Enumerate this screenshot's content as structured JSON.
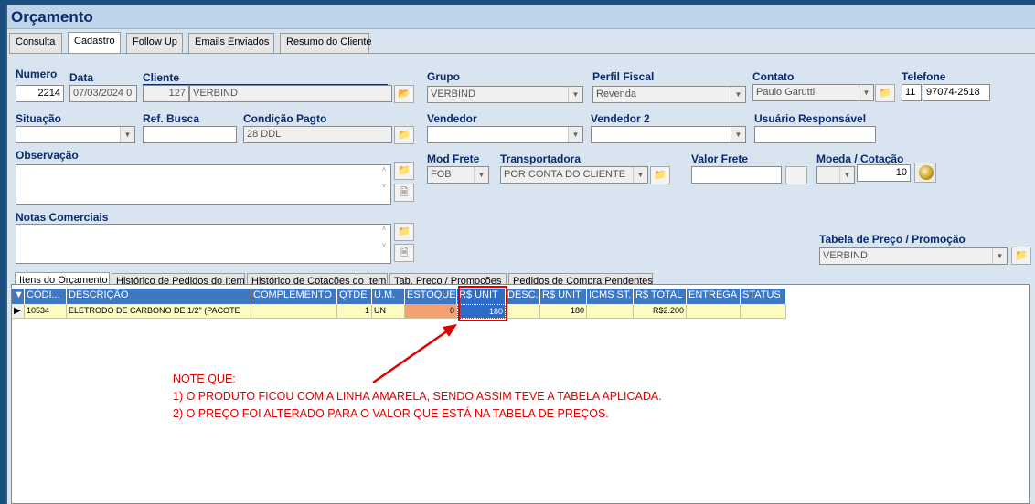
{
  "window": {
    "title": "Orçamento"
  },
  "top_tabs": [
    "Consulta",
    "Cadastro",
    "Follow Up",
    "Emails Enviados",
    "Resumo do Cliente"
  ],
  "form": {
    "numero_label": "Numero",
    "numero": "2214",
    "data_label": "Data",
    "data": "07/03/2024 0",
    "cliente_label": "Cliente",
    "cliente_codigo": "127",
    "cliente_nome": "VERBIND",
    "grupo_label": "Grupo",
    "grupo": "VERBIND",
    "perfil_fiscal_label": "Perfil Fiscal",
    "perfil_fiscal": "Revenda",
    "contato_label": "Contato",
    "contato": "Paulo Garutti",
    "telefone_label": "Telefone",
    "telefone_ddd": "11",
    "telefone": "97074-2518",
    "situacao_label": "Situação",
    "situacao": "",
    "ref_busca_label": "Ref. Busca",
    "ref_busca": "",
    "condicao_pagto_label": "Condição Pagto",
    "condicao_pagto": "28 DDL",
    "vendedor_label": "Vendedor",
    "vendedor": "",
    "vendedor2_label": "Vendedor 2",
    "vendedor2": "",
    "usuario_responsavel_label": "Usuário Responsável",
    "usuario_responsavel": "",
    "observacao_label": "Observação",
    "mod_frete_label": "Mod Frete",
    "mod_frete": "FOB",
    "transportadora_label": "Transportadora",
    "transportadora": "POR CONTA DO CLIENTE",
    "valor_frete_label": "Valor Frete",
    "valor_frete": "",
    "moeda_label": "Moeda / Cotação",
    "moeda": "",
    "cotacao": "10",
    "notas_comerciais_label": "Notas Comerciais",
    "tabela_preco_label": "Tabela de Preço / Promoção",
    "tabela_preco": "VERBIND"
  },
  "item_tabs": [
    "Itens do Orçamento",
    "Histórico de Pedidos do Item",
    "Histórico de Cotações do Item",
    "Tab. Preço / Promoções",
    "Pedidos de Compra Pendentes"
  ],
  "grid": {
    "headers": [
      "CÓDI...",
      "DESCRIÇÃO",
      "COMPLEMENTO",
      "QTDE",
      "U.M.",
      "ESTOQUE",
      "R$ UNIT",
      "DESC.",
      "R$ UNIT",
      "ICMS ST.",
      "R$ TOTAL",
      "ENTREGA",
      "STATUS"
    ],
    "rows": [
      {
        "codigo": "10534",
        "descricao": "ELETRODO DE CARBONO DE 1/2\" (PACOTE",
        "complemento": "",
        "qtde": "1",
        "um": "UN",
        "estoque": "0",
        "rs_unit": "180",
        "desc": "",
        "rs_unit2": "180",
        "icms_st": "",
        "rs_total": "R$2.200",
        "entrega": "",
        "status": ""
      }
    ]
  },
  "note": {
    "lines": [
      "NOTE QUE:",
      "1) O PRODUTO FICOU COM A LINHA AMARELA, SENDO ASSIM TEVE A TABELA APLICADA.",
      "2) O PREÇO FOI ALTERADO PARA O VALOR QUE ESTÁ NA TABELA DE PREÇOS."
    ],
    "color": "#e00000"
  },
  "colors": {
    "header_blue": "#3e78c0",
    "row_yellow": "#fdfbc0",
    "estoque_orange": "#f4a070",
    "selected_cell": "#2f6cc7"
  }
}
